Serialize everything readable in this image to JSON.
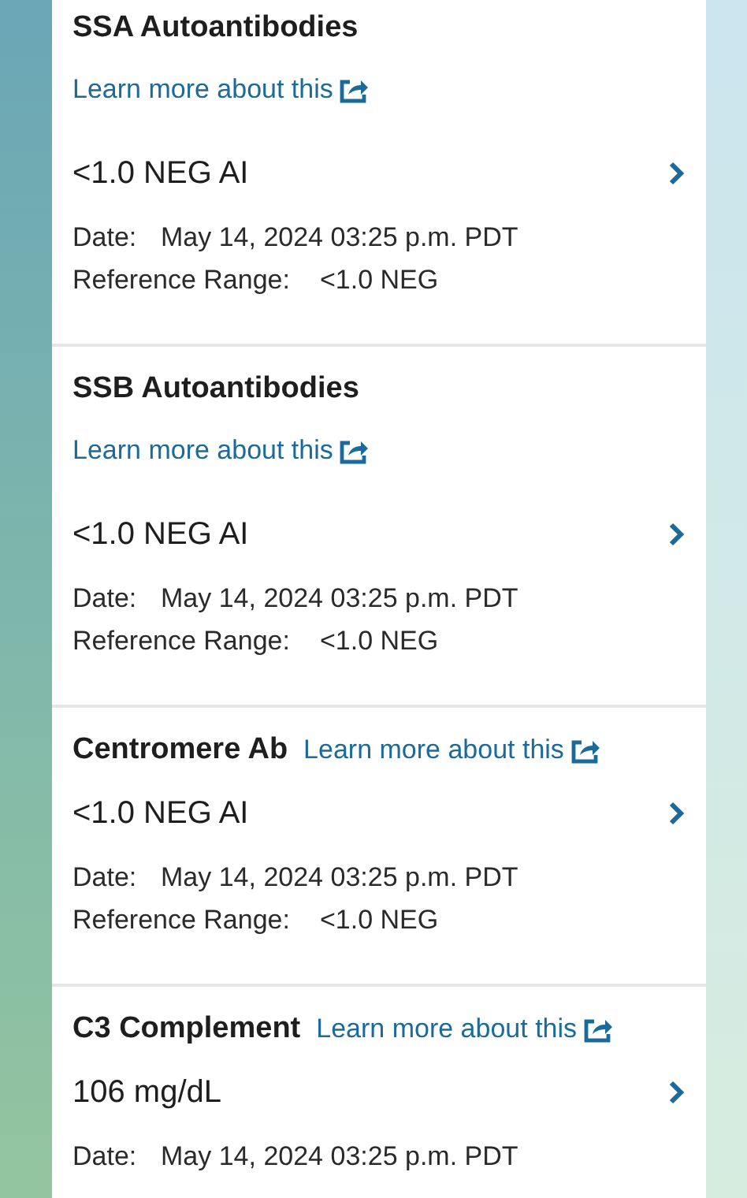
{
  "results": [
    {
      "kind": "stacked",
      "title": "SSA Autoantibodies",
      "link": "Learn more about this",
      "value": "<1.0 NEG AI",
      "date_label": "Date:",
      "date": "May 14, 2024 03:25 p.m. PDT",
      "range_label": "Reference Range:",
      "range": "<1.0 NEG"
    },
    {
      "kind": "stacked",
      "title": "SSB Autoantibodies",
      "link": "Learn more about this",
      "value": "<1.0 NEG AI",
      "date_label": "Date:",
      "date": "May 14, 2024 03:25 p.m. PDT",
      "range_label": "Reference Range:",
      "range": "<1.0 NEG"
    },
    {
      "kind": "inline",
      "title": "Centromere Ab",
      "link": "Learn more about this",
      "value": "<1.0 NEG AI",
      "date_label": "Date:",
      "date": "May 14, 2024 03:25 p.m. PDT",
      "range_label": "Reference Range:",
      "range": "<1.0 NEG"
    },
    {
      "kind": "inline",
      "title": "C3 Complement",
      "link": "Learn more about this",
      "value": "106 mg/dL",
      "date_label": "Date:",
      "date": "May 14, 2024 03:25 p.m. PDT"
    }
  ]
}
